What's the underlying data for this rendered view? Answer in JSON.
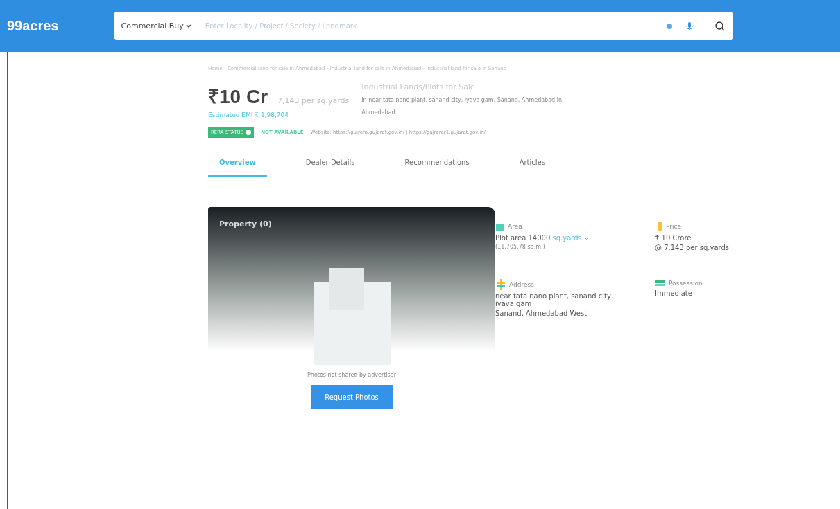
{
  "header": {
    "logo": "99acres",
    "search": {
      "category": "Commercial Buy",
      "placeholder": "Enter Locality / Project / Society / Landmark"
    }
  },
  "breadcrumb": "Home › Commercial land for sale in Ahmedabad › Industrial land for sale in Ahmedabad › Industrial land for sale in Sanand",
  "summary": {
    "price": "₹10 Cr",
    "rate": "7,143 per sq.yards",
    "emi": "Estimated EMI ₹ 1,98,704",
    "title": "Industrial Lands/Plots for Sale",
    "location": "in near tata nano plant, sanand city, iyava gam, Sanand, Ahmedabad in Ahmedabad"
  },
  "rera": {
    "badge": "RERA STATUS",
    "status": "NOT AVAILABLE",
    "website": "Website: https://gujrera.gujarat.gov.in/ | https://gujrerar1.gujarat.gov.in/"
  },
  "tabs": [
    {
      "label": "Overview",
      "selected": true
    },
    {
      "label": "Dealer Details",
      "selected": false
    },
    {
      "label": "Recommendations",
      "selected": false
    },
    {
      "label": "Articles",
      "selected": false
    }
  ],
  "gallery": {
    "title": "Property (0)",
    "note": "Photos not shared by advertiser",
    "button": "Request Photos"
  },
  "details": [
    {
      "kind": "area",
      "label": "Area",
      "lines": [
        "Plot area 14000"
      ],
      "unit": "sq.yards",
      "sub": "(11,705.78 sq.m.)"
    },
    {
      "kind": "price",
      "label": "Price",
      "lines": [
        "₹ 10 Crore",
        "@ 7,143 per sq.yards"
      ]
    },
    {
      "kind": "address",
      "label": "Address",
      "lines": [
        "near tata nano plant, sanand city, iyava gam",
        "Sanand, Ahmedabad West"
      ]
    },
    {
      "kind": "possession",
      "label": "Possession",
      "lines": [
        "Immediate"
      ]
    }
  ]
}
